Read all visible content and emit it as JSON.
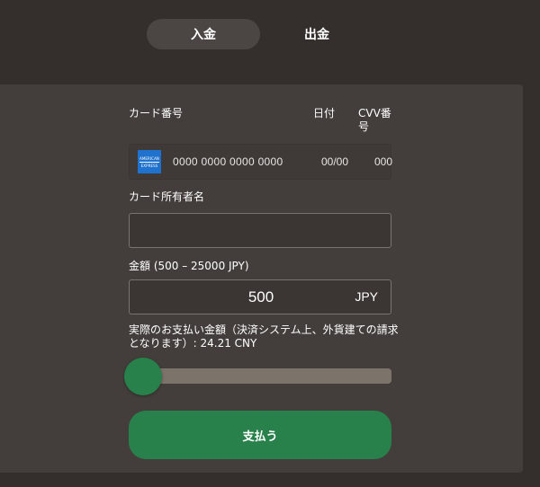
{
  "tabs": [
    {
      "label": "入金",
      "active": true
    },
    {
      "label": "出金",
      "active": false
    }
  ],
  "form": {
    "card_number_label": "カード番号",
    "date_label": "日付",
    "cvv_label_line1": "CVV番",
    "cvv_label_line2": "号",
    "card_brand_line1": "AMERICAN",
    "card_brand_line2": "EXPRESS",
    "card_number_placeholder": "0000 0000 0000 0000",
    "date_placeholder": "00/00",
    "cvv_placeholder": "000",
    "holder_label": "カード所有者名",
    "holder_value": "",
    "amount_label": "金額 (500 – 25000 JPY)",
    "amount_value": "500",
    "amount_currency": "JPY",
    "note_line1": "実際のお支払い金額（決済システム上、外貨建ての請求",
    "note_line2": "となります）:  24.21 CNY",
    "slider_fraction": 0.0,
    "pay_label": "支払う"
  },
  "colors": {
    "background": "#342f2c",
    "panel": "#433e3b",
    "accent_green": "#28804a",
    "slider_track": "#7c736b",
    "amex_blue": "#1f72cd"
  },
  "icons": {
    "card_brand": "amex-card-icon"
  }
}
